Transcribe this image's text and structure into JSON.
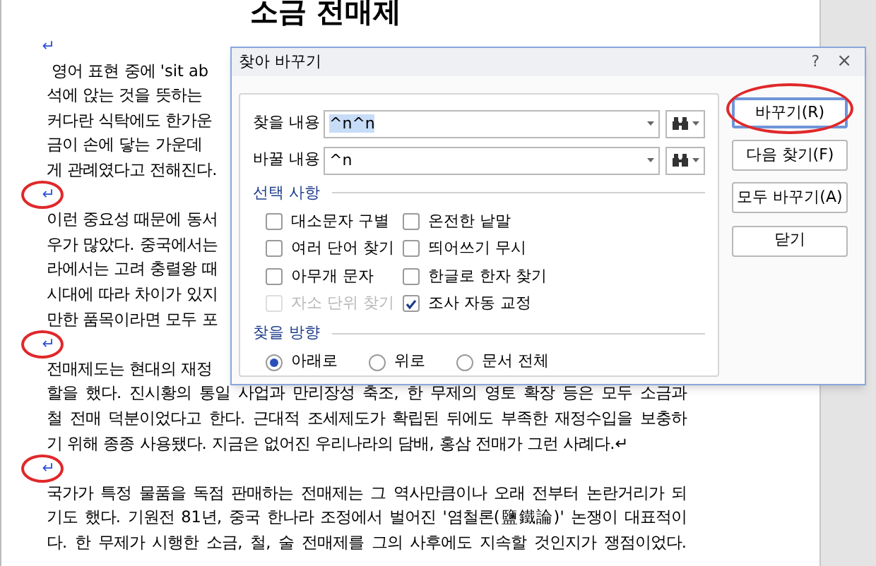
{
  "document": {
    "title": "소금 전매제",
    "lines": [
      {
        "text": "↵",
        "kind": "mark"
      },
      {
        "text": " 영어 표현 중에 'sit ab",
        "kind": "cut"
      },
      {
        "text": "석에 앉는 것을 뜻하는",
        "kind": "cut"
      },
      {
        "text": "커다란 식탁에도 한가운",
        "kind": "cut"
      },
      {
        "text": "금이 손에 닿는 가운데",
        "kind": "cut"
      },
      {
        "text": "게 관례였다고 전해진다.",
        "kind": "cut"
      },
      {
        "text": "↵",
        "kind": "circled_mark"
      },
      {
        "text": "이런 중요성 때문에 동서",
        "kind": "cut"
      },
      {
        "text": "우가 많았다. 중국에서는",
        "kind": "cut"
      },
      {
        "text": "라에서는 고려 충렬왕 때",
        "kind": "cut"
      },
      {
        "text": "시대에 따라 차이가 있지",
        "kind": "cut"
      },
      {
        "text": "만한 품목이라면 모두 포",
        "kind": "cut"
      },
      {
        "text": "↵",
        "kind": "circled_mark"
      },
      {
        "text": "전매제도는 현대의 재정",
        "kind": "cut"
      },
      {
        "text": "할을 했다. 진시황의 통일 사업과 만리장성 축조, 한 무제의 영토 확장 등은 모두 소금과",
        "kind": "full"
      },
      {
        "text": "철 전매 덕분이었다고 한다. 근대적 조세제도가 확립된 뒤에도 부족한 재정수입을 보충하",
        "kind": "full"
      },
      {
        "text": "기 위해 종종 사용됐다. 지금은 없어진 우리나라의 담배, 홍삼 전매가 그런 사례다.↵",
        "kind": "cut"
      },
      {
        "text": "↵",
        "kind": "circled_mark"
      },
      {
        "text": "국가가 특정 물품을 독점 판매하는 전매제는 그 역사만큼이나 오래 전부터 논란거리가 되",
        "kind": "full"
      },
      {
        "text": "기도 했다. 기원전 81년, 중국 한나라 조정에서 벌어진 '염철론(鹽鐵論)' 논쟁이 대표적이",
        "kind": "full"
      },
      {
        "text": "다. 한 무제가 시행한 소금, 철, 술 전매제를 그의 사후에도 지속할 것인지가 쟁점이었다.",
        "kind": "full"
      }
    ]
  },
  "dialog": {
    "title": "찾아 바꾸기",
    "help": "?",
    "close": "×",
    "fields": [
      {
        "label": "찾을 내용",
        "value": "^n^n",
        "highlighted": true
      },
      {
        "label": "바꿀 내용",
        "value": "^n",
        "highlighted": false
      }
    ],
    "options_title": "선택 사항",
    "options": [
      {
        "label": "대소문자 구별",
        "checked": false,
        "disabled": false
      },
      {
        "label": "온전한 낱말",
        "checked": false,
        "disabled": false
      },
      {
        "label": "여러 단어 찾기",
        "checked": false,
        "disabled": false
      },
      {
        "label": "띄어쓰기 무시",
        "checked": false,
        "disabled": false
      },
      {
        "label": "아무개 문자",
        "checked": false,
        "disabled": false
      },
      {
        "label": "한글로 한자 찾기",
        "checked": false,
        "disabled": false
      },
      {
        "label": "자소 단위 찾기",
        "checked": false,
        "disabled": true
      },
      {
        "label": "조사 자동 교정",
        "checked": true,
        "disabled": false
      }
    ],
    "direction_title": "찾을 방향",
    "directions": [
      {
        "label": "아래로",
        "selected": true
      },
      {
        "label": "위로",
        "selected": false
      },
      {
        "label": "문서 전체",
        "selected": false
      }
    ],
    "buttons": [
      {
        "label": "바꾸기(R)",
        "default": true,
        "circled": true
      },
      {
        "label": "다음 찾기(F)",
        "default": false,
        "circled": false
      },
      {
        "label": "모두 바꾸기(A)",
        "default": false,
        "circled": false
      },
      {
        "label": "닫기",
        "default": false,
        "circled": false
      }
    ]
  }
}
